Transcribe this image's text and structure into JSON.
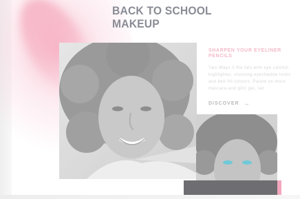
{
  "header": {
    "headline_line1": "BACK TO SCHOOL",
    "headline_line2": "MAKEUP"
  },
  "promo": {
    "title_line1": "SHARPEN YOUR EYELINER",
    "title_line2": "PENCILS",
    "body_lines": [
      "Two-Ways it the fals with eye catchin",
      "highlighter, stunning eyeshadow looks",
      "and bell-fill colours. Palate on more",
      "mascara and glitz gel, set"
    ],
    "discover_label": "DISCOVER",
    "discover_arrow": "→"
  },
  "colors": {
    "headline": "#8a8c95",
    "promo_title": "#f3b9c8",
    "accent_dark": "#6d6d72",
    "accent_pink": "#f3a7bc"
  },
  "images": {
    "main_photo": "portrait-curly-hair-woman",
    "second_photo": "portrait-blue-eyeshadow-woman"
  }
}
